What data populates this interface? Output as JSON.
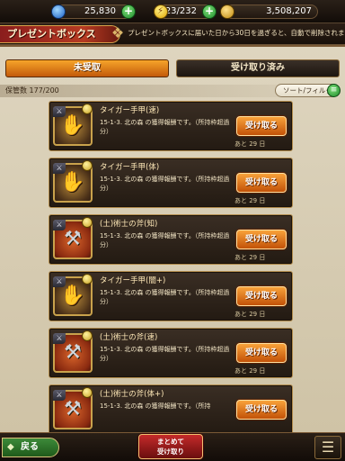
{
  "resources": {
    "gems": "25,830",
    "stamina": "223/232",
    "gold": "3,508,207"
  },
  "header": {
    "title": "プレゼントボックス",
    "note": "プレゼントボックスに届いた日から30日を過ぎると、自動で削除されます。"
  },
  "tabs": {
    "unreceived": "未受取",
    "received": "受け取り済み"
  },
  "storage": {
    "label": "保管数 177/200",
    "sort_label": "ソート/フィルタ"
  },
  "items": [
    {
      "name": "タイガー手甲(速)",
      "desc": "15-1-3. 北の森 の獲得報酬です。（所持枠超過分）",
      "date": "あと 29 日",
      "button": "受け取る",
      "icon": "tiger-gauntlet-icon"
    },
    {
      "name": "タイガー手甲(体)",
      "desc": "15-1-3. 北の森 の獲得報酬です。（所持枠超過分）",
      "date": "あと 29 日",
      "button": "受け取る",
      "icon": "tiger-gauntlet-icon"
    },
    {
      "name": "(土)術士の斧(知)",
      "desc": "15-1-3. 北の森 の獲得報酬です。（所持枠超過分）",
      "date": "あと 29 日",
      "button": "受け取る",
      "icon": "earth-axe-icon"
    },
    {
      "name": "タイガー手甲(闇+)",
      "desc": "15-1-3. 北の森 の獲得報酬です。（所持枠超過分）",
      "date": "あと 29 日",
      "button": "受け取る",
      "icon": "tiger-gauntlet-icon"
    },
    {
      "name": "(土)術士の斧(速)",
      "desc": "15-1-3. 北の森 の獲得報酬です。（所持枠超過分）",
      "date": "あと 29 日",
      "button": "受け取る",
      "icon": "earth-axe-icon"
    },
    {
      "name": "(土)術士の斧(体+)",
      "desc": "15-1-3. 北の森 の獲得報酬です。（所持",
      "date": "",
      "button": "受け取る",
      "icon": "earth-axe-icon"
    }
  ],
  "footer": {
    "back": "戻る",
    "bulk_line1": "まとめて",
    "bulk_line2": "受け取り",
    "menu": "☰"
  }
}
